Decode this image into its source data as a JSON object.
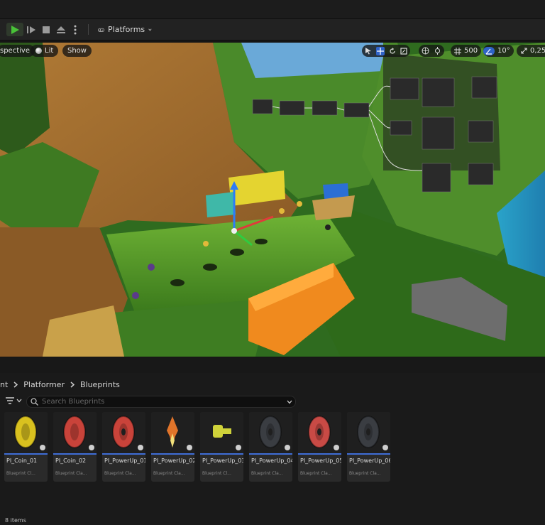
{
  "toolbar": {
    "platforms_label": "Platforms",
    "play_icon": "play-icon",
    "step_icon": "advance-frame-icon",
    "stop_icon": "stop-icon",
    "eject_icon": "eject-icon",
    "more_icon": "vertical-dots-icon",
    "platforms_icon": "gamepad-icon"
  },
  "viewport": {
    "perspective_label": "spective",
    "lit_label": "Lit",
    "show_label": "Show",
    "grid_snap_value": "500",
    "rotation_snap_value": "10°",
    "scale_snap_value": "0,25"
  },
  "content_browser": {
    "breadcrumbs": [
      "nt",
      "Platformer",
      "Blueprints"
    ],
    "search_placeholder": "Search Blueprints",
    "items_count": "8 items",
    "assets": [
      {
        "name": "PI_Coin_01",
        "class": "Blueprint Cl...",
        "color": "#d9c11f"
      },
      {
        "name": "PI_Coin_02",
        "class": "Blueprint Cla...",
        "color": "#c9433a"
      },
      {
        "name": "PI_PowerUp_01",
        "class": "Blueprint Cla...",
        "color": "#c9433a"
      },
      {
        "name": "PI_PowerUp_02",
        "class": "Blueprint Cla...",
        "color": "#e0742a"
      },
      {
        "name": "PI_PowerUp_03",
        "class": "Blueprint Cl...",
        "color": "#cfd23a"
      },
      {
        "name": "PI_PowerUp_04",
        "class": "Blueprint Cla...",
        "color": "#3a3d42"
      },
      {
        "name": "PI_PowerUp_05",
        "class": "Blueprint Cla...",
        "color": "#c84a45"
      },
      {
        "name": "PI_PowerUp_06",
        "class": "Blueprint Cla...",
        "color": "#3a3d42"
      }
    ]
  },
  "colors": {
    "accent_blue": "#3f6dd6",
    "play_green": "#49c238",
    "panel_bg": "#1a1a1a"
  }
}
